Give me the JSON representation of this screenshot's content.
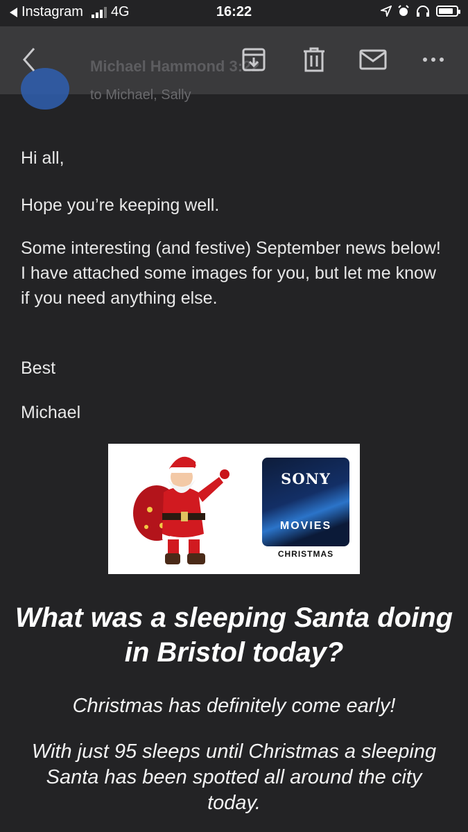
{
  "status_bar": {
    "back_app": "Instagram",
    "network": "4G",
    "time": "16:22"
  },
  "toolbar": {
    "sender_name_faded": "Michael Hammond",
    "sender_time_faded": "3:22",
    "recipients_faded": "to Michael, Sally",
    "icons": [
      "back-icon",
      "archive-icon",
      "trash-icon",
      "mail-icon",
      "more-icon"
    ]
  },
  "email": {
    "greeting": "Hi all,",
    "hope": "Hope you’re keeping well.",
    "news": "Some interesting (and festive) September news below! I have attached some images for you, but let me know if you need anything else.",
    "signoff": "Best",
    "signature": "Michael"
  },
  "banner": {
    "logo_top": "SONY",
    "logo_mid": "MOVIES",
    "logo_bottom": "CHRISTMAS"
  },
  "article": {
    "headline": "What was a sleeping Santa doing in Bristol today?",
    "subhead": "Christmas has definitely come early!",
    "body": "With just 95 sleeps until Christmas a sleeping Santa has been spotted all around the city today."
  },
  "colors": {
    "background": "#232325",
    "toolbar": "#3a3a3c",
    "text": "#e8e8e8"
  }
}
